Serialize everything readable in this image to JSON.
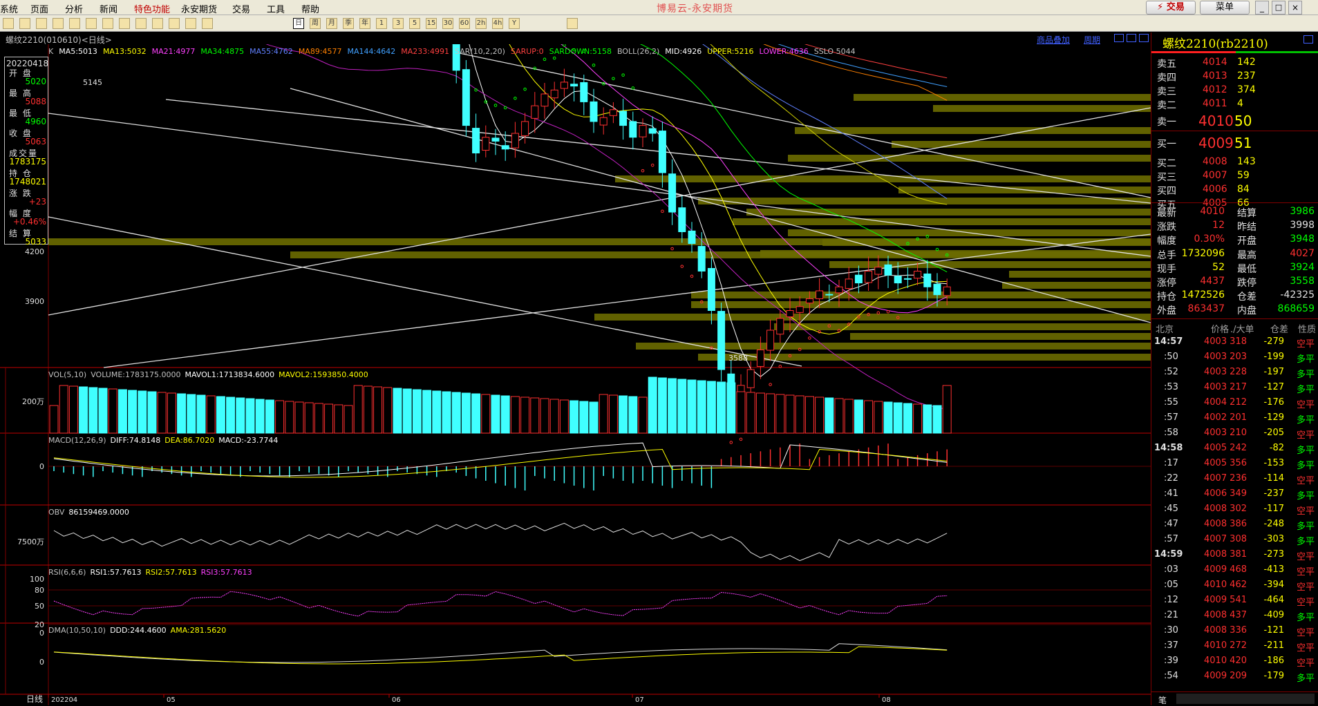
{
  "window": {
    "title": "博易云-永安期货",
    "trade_btn": "⚡ 交易",
    "menu_btn": "菜单"
  },
  "menu": [
    "系统",
    "页面",
    "分析",
    "新闻",
    "特色功能",
    "永安期货",
    "交易",
    "工具",
    "帮助"
  ],
  "toolbar": {
    "buttons": [
      "日",
      "周",
      "月",
      "季",
      "年",
      "1",
      "3",
      "5",
      "15",
      "30",
      "60",
      "2h",
      "4h",
      "Y"
    ]
  },
  "header": {
    "symbol_code": "螺纹2210(010610)<日线>",
    "right_links": [
      "商品叠加",
      "周期"
    ]
  },
  "main_legend": {
    "prefix": "K",
    "items": [
      {
        "t": "MA5:5013",
        "c": "#ffffff"
      },
      {
        "t": "MA13:5032",
        "c": "#ffff00"
      },
      {
        "t": "MA21:4977",
        "c": "#ff40ff"
      },
      {
        "t": "MA34:4875",
        "c": "#00ff00"
      },
      {
        "t": "MA55:4762",
        "c": "#6080ff"
      },
      {
        "t": "MA89:4577",
        "c": "#ff8000"
      },
      {
        "t": "MA144:4642",
        "c": "#40a0ff"
      },
      {
        "t": "MA233:4991",
        "c": "#ff4040"
      },
      {
        "t": "SAR(10,2,20)",
        "c": "#c0c0c0"
      },
      {
        "t": "SARUP:0",
        "c": "#ff4040"
      },
      {
        "t": "SARDOWN:5158",
        "c": "#00ff00"
      },
      {
        "t": "BOLL(26,2)",
        "c": "#c0c0c0"
      },
      {
        "t": "MID:4926",
        "c": "#ffffff"
      },
      {
        "t": "UPPER:5216",
        "c": "#ffff00"
      },
      {
        "t": "LOWER:4636",
        "c": "#ff40ff"
      },
      {
        "t": "SSLO 5044",
        "c": "#c0c0c0"
      }
    ]
  },
  "info_box": {
    "date": "20220418",
    "rows": [
      {
        "label": "开 盘",
        "value": "5020",
        "color": "#00ff00"
      },
      {
        "label": "最 高",
        "value": "5088",
        "color": "#ff3030"
      },
      {
        "label": "最 低",
        "value": "4960",
        "color": "#00ff00"
      },
      {
        "label": "收 盘",
        "value": "5063",
        "color": "#ff3030"
      },
      {
        "label": "成交量",
        "value": "1783175",
        "color": "#ffff00"
      },
      {
        "label": "持 仓",
        "value": "1748021",
        "color": "#ffff00"
      },
      {
        "label": "涨 跌",
        "value": "+23",
        "color": "#ff3030"
      },
      {
        "label": "幅 度",
        "value": "+0.46%",
        "color": "#ff3030"
      },
      {
        "label": "结 算",
        "value": "5033",
        "color": "#ffff00"
      }
    ]
  },
  "price_axis": [
    "4200",
    "3900"
  ],
  "price_annotations": {
    "high": "5145",
    "low": "3588"
  },
  "panels": [
    {
      "id": "vol",
      "legend": [
        {
          "t": "VOL(5,10)",
          "c": "#c0c0c0"
        },
        {
          "t": "VOLUME:1783175.0000",
          "c": "#c0c0c0"
        },
        {
          "t": "MAVOL1:1713834.6000",
          "c": "#ffffff"
        },
        {
          "t": "MAVOL2:1593850.4000",
          "c": "#ffff00"
        }
      ],
      "axis": [
        "200万"
      ]
    },
    {
      "id": "macd",
      "legend": [
        {
          "t": "MACD(12,26,9)",
          "c": "#c0c0c0"
        },
        {
          "t": "DIFF:74.8148",
          "c": "#ffffff"
        },
        {
          "t": "DEA:86.7020",
          "c": "#ffff00"
        },
        {
          "t": "MACD:-23.7744",
          "c": "#ffffff"
        }
      ],
      "axis": [
        "0"
      ]
    },
    {
      "id": "obv",
      "legend": [
        {
          "t": "OBV",
          "c": "#c0c0c0"
        },
        {
          "t": "86159469.0000",
          "c": "#ffffff"
        }
      ],
      "axis": [
        "7500万"
      ]
    },
    {
      "id": "rsi",
      "legend": [
        {
          "t": "RSI(6,6,6)",
          "c": "#c0c0c0"
        },
        {
          "t": "RSI1:57.7613",
          "c": "#ffffff"
        },
        {
          "t": "RSI2:57.7613",
          "c": "#ffff00"
        },
        {
          "t": "RSI3:57.7613",
          "c": "#ff40ff"
        }
      ],
      "axis": [
        "100",
        "80",
        "50",
        "20",
        "0"
      ]
    },
    {
      "id": "dma",
      "legend": [
        {
          "t": "DMA(10,50,10)",
          "c": "#c0c0c0"
        },
        {
          "t": "DDD:244.4600",
          "c": "#ffffff"
        },
        {
          "t": "AMA:281.5620",
          "c": "#ffff00"
        }
      ],
      "axis": [
        "0"
      ]
    }
  ],
  "bottom": {
    "period": "日线",
    "dates": [
      "202204",
      "05",
      "06",
      "07",
      "08"
    ]
  },
  "quote": {
    "title": "螺纹2210(rb2210)",
    "asks": [
      {
        "label": "卖五",
        "price": "4014",
        "vol": "142"
      },
      {
        "label": "卖四",
        "price": "4013",
        "vol": "237"
      },
      {
        "label": "卖三",
        "price": "4012",
        "vol": "374"
      },
      {
        "label": "卖二",
        "price": "4011",
        "vol": "4"
      },
      {
        "label": "卖一",
        "price": "4010",
        "vol": "50"
      }
    ],
    "bids": [
      {
        "label": "买一",
        "price": "4009",
        "vol": "51"
      },
      {
        "label": "买二",
        "price": "4008",
        "vol": "143"
      },
      {
        "label": "买三",
        "price": "4007",
        "vol": "59"
      },
      {
        "label": "买四",
        "price": "4006",
        "vol": "84"
      },
      {
        "label": "买五",
        "price": "4005",
        "vol": "66"
      }
    ],
    "stats": [
      {
        "l1": "最新",
        "v1": "4010",
        "c1": "#ff3030",
        "l2": "结算",
        "v2": "3986",
        "c2": "#00ff00"
      },
      {
        "l1": "涨跌",
        "v1": "12",
        "c1": "#ff3030",
        "l2": "昨结",
        "v2": "3998",
        "c2": "#e0e0e0"
      },
      {
        "l1": "幅度",
        "v1": "0.30%",
        "c1": "#ff3030",
        "l2": "开盘",
        "v2": "3948",
        "c2": "#00ff00"
      },
      {
        "l1": "总手",
        "v1": "1732096",
        "c1": "#ffff00",
        "l2": "最高",
        "v2": "4027",
        "c2": "#ff3030"
      },
      {
        "l1": "现手",
        "v1": "52",
        "c1": "#ffff00",
        "l2": "最低",
        "v2": "3924",
        "c2": "#00ff00"
      },
      {
        "l1": "涨停",
        "v1": "4437",
        "c1": "#ff3030",
        "l2": "跌停",
        "v2": "3558",
        "c2": "#00ff00"
      },
      {
        "l1": "持仓",
        "v1": "1472526",
        "c1": "#ffff00",
        "l2": "仓差",
        "v2": "-42325",
        "c2": "#e0e0e0"
      },
      {
        "l1": "外盘",
        "v1": "863437",
        "c1": "#ff3030",
        "l2": "内盘",
        "v2": "868659",
        "c2": "#00ff00"
      }
    ],
    "trades_header": [
      "北京",
      "价格",
      "./大单",
      "仓差",
      "性质"
    ],
    "trades": [
      {
        "t": "14:57",
        "p": "4003",
        "v": "318",
        "d": "-279",
        "n": "空平",
        "nc": "#ff3030"
      },
      {
        "t": ":50",
        "p": "4003",
        "v": "203",
        "d": "-199",
        "n": "多平",
        "nc": "#00ff00"
      },
      {
        "t": ":52",
        "p": "4003",
        "v": "228",
        "d": "-197",
        "n": "多平",
        "nc": "#00ff00"
      },
      {
        "t": ":53",
        "p": "4003",
        "v": "217",
        "d": "-127",
        "n": "多平",
        "nc": "#00ff00"
      },
      {
        "t": ":55",
        "p": "4004",
        "v": "212",
        "d": "-176",
        "n": "空平",
        "nc": "#ff3030"
      },
      {
        "t": ":57",
        "p": "4002",
        "v": "201",
        "d": "-129",
        "n": "多平",
        "nc": "#00ff00"
      },
      {
        "t": ":58",
        "p": "4003",
        "v": "210",
        "d": "-205",
        "n": "空平",
        "nc": "#ff3030"
      },
      {
        "t": "14:58",
        "p": "4005",
        "v": "242",
        "d": "-82",
        "n": "多平",
        "nc": "#00ff00"
      },
      {
        "t": ":17",
        "p": "4005",
        "v": "356",
        "d": "-153",
        "n": "多平",
        "nc": "#00ff00"
      },
      {
        "t": ":22",
        "p": "4007",
        "v": "236",
        "d": "-114",
        "n": "空平",
        "nc": "#ff3030"
      },
      {
        "t": ":41",
        "p": "4006",
        "v": "349",
        "d": "-237",
        "n": "多平",
        "nc": "#00ff00"
      },
      {
        "t": ":45",
        "p": "4008",
        "v": "302",
        "d": "-117",
        "n": "空平",
        "nc": "#ff3030"
      },
      {
        "t": ":47",
        "p": "4008",
        "v": "386",
        "d": "-248",
        "n": "多平",
        "nc": "#00ff00"
      },
      {
        "t": ":57",
        "p": "4007",
        "v": "308",
        "d": "-303",
        "n": "多平",
        "nc": "#00ff00"
      },
      {
        "t": "14:59",
        "p": "4008",
        "v": "381",
        "d": "-273",
        "n": "空平",
        "nc": "#ff3030"
      },
      {
        "t": ":03",
        "p": "4009",
        "v": "468",
        "d": "-413",
        "n": "空平",
        "nc": "#ff3030"
      },
      {
        "t": ":05",
        "p": "4010",
        "v": "462",
        "d": "-394",
        "n": "空平",
        "nc": "#ff3030"
      },
      {
        "t": ":12",
        "p": "4009",
        "v": "541",
        "d": "-464",
        "n": "空平",
        "nc": "#ff3030"
      },
      {
        "t": ":21",
        "p": "4008",
        "v": "437",
        "d": "-409",
        "n": "多平",
        "nc": "#00ff00"
      },
      {
        "t": ":30",
        "p": "4008",
        "v": "336",
        "d": "-121",
        "n": "空平",
        "nc": "#ff3030"
      },
      {
        "t": ":37",
        "p": "4010",
        "v": "272",
        "d": "-211",
        "n": "空平",
        "nc": "#ff3030"
      },
      {
        "t": ":39",
        "p": "4010",
        "v": "420",
        "d": "-186",
        "n": "空平",
        "nc": "#ff3030"
      },
      {
        "t": ":54",
        "p": "4009",
        "v": "209",
        "d": "-179",
        "n": "多平",
        "nc": "#00ff00"
      }
    ],
    "footer_tab": "笔"
  }
}
